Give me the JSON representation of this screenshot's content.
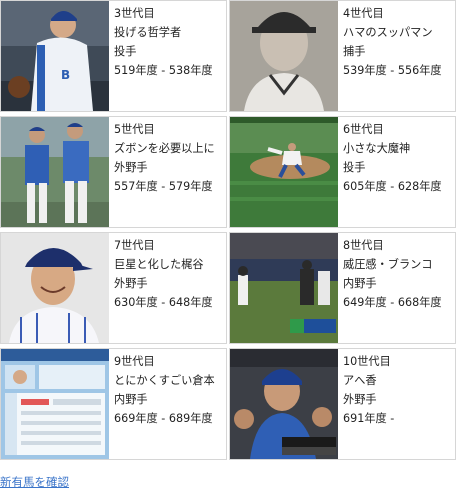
{
  "cards": [
    {
      "generation": "3世代目",
      "nickname": "投げる哲学者",
      "position": "投手",
      "years": "519年度 - 538年度",
      "thumb_icon": "pitcher-photo"
    },
    {
      "generation": "4世代目",
      "nickname": "ハマのスッパマン",
      "position": "捕手",
      "years": "539年度 - 556年度",
      "thumb_icon": "catcher-portrait-photo"
    },
    {
      "generation": "5世代目",
      "nickname": "ズボンを必要以上に",
      "position": "外野手",
      "years": "557年度 - 579年度",
      "thumb_icon": "two-players-photo"
    },
    {
      "generation": "6世代目",
      "nickname": "小さな大魔神",
      "position": "投手",
      "years": "605年度 - 628年度",
      "thumb_icon": "pitching-field-photo"
    },
    {
      "generation": "7世代目",
      "nickname": "巨星と化した梶谷",
      "position": "外野手",
      "years": "630年度 - 648年度",
      "thumb_icon": "outfielder-portrait-photo"
    },
    {
      "generation": "8世代目",
      "nickname": "威圧感・ブランコ",
      "position": "内野手",
      "years": "649年度 - 668年度",
      "thumb_icon": "batting-game-photo"
    },
    {
      "generation": "9世代目",
      "nickname": "とにかくすごい倉本",
      "position": "内野手",
      "years": "669年度 - 689年度",
      "thumb_icon": "game-screen-image"
    },
    {
      "generation": "10世代目",
      "nickname": "アへ香",
      "position": "外野手",
      "years": "691年度 -",
      "thumb_icon": "dugout-photo"
    }
  ],
  "footer_link": "新有馬を確認"
}
